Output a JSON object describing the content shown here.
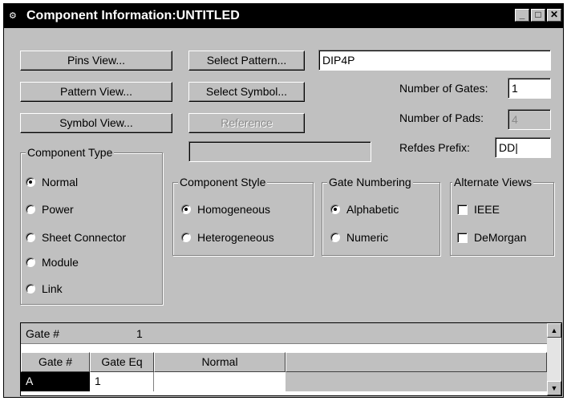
{
  "window": {
    "title": "Component Information:UNTITLED",
    "controls": {
      "minimize": "_",
      "maximize": "□",
      "close": "✕"
    }
  },
  "buttons": {
    "pins_view": "Pins View...",
    "pattern_view": "Pattern View...",
    "symbol_view": "Symbol View...",
    "select_pattern": "Select Pattern...",
    "select_symbol": "Select Symbol...",
    "reference": "Reference"
  },
  "fields": {
    "pattern_name": "DIP4P",
    "number_of_gates_label": "Number of Gates:",
    "number_of_gates": "1",
    "number_of_pads_label": "Number of Pads:",
    "number_of_pads": "4",
    "refdes_prefix_label": "Refdes Prefix:",
    "refdes_prefix": "DD|",
    "reference_value": ""
  },
  "component_type": {
    "title": "Component Type",
    "options": [
      "Normal",
      "Power",
      "Sheet Connector",
      "Module",
      "Link"
    ],
    "selected": "Normal"
  },
  "component_style": {
    "title": "Component Style",
    "options": [
      "Homogeneous",
      "Heterogeneous"
    ],
    "selected": "Homogeneous"
  },
  "gate_numbering": {
    "title": "Gate Numbering",
    "options": [
      "Alphabetic",
      "Numeric"
    ],
    "selected": "Alphabetic"
  },
  "alternate_views": {
    "title": "Alternate Views",
    "options": [
      {
        "label": "IEEE",
        "checked": false
      },
      {
        "label": "DeMorgan",
        "checked": false
      }
    ]
  },
  "gate_table": {
    "gate_label": "Gate #",
    "gate_value": "1",
    "headers": [
      "Gate #",
      "Gate Eq",
      "Normal"
    ],
    "rows": [
      [
        "A",
        "1",
        ""
      ]
    ]
  }
}
